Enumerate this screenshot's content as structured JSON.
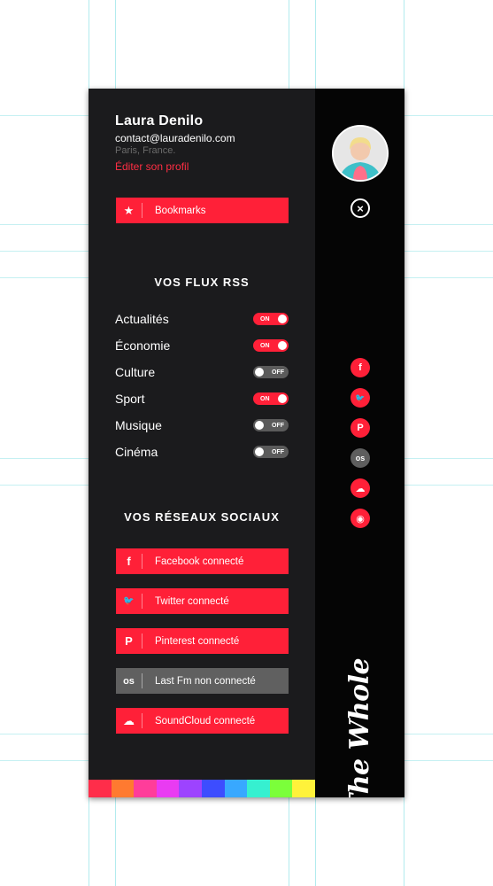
{
  "profile": {
    "name": "Laura Denilo",
    "email": "contact@lauradenilo.com",
    "location": "Paris, France.",
    "edit_label": "Éditer son profil"
  },
  "bookmarks": {
    "label": "Bookmarks",
    "icon": "star-icon"
  },
  "rss": {
    "title": "VOS FLUX RSS",
    "feeds": [
      {
        "label": "Actualités",
        "state": "ON",
        "enabled": true
      },
      {
        "label": "Économie",
        "state": "ON",
        "enabled": true
      },
      {
        "label": "Culture",
        "state": "OFF",
        "enabled": false
      },
      {
        "label": "Sport",
        "state": "ON",
        "enabled": true
      },
      {
        "label": "Musique",
        "state": "OFF",
        "enabled": false
      },
      {
        "label": "Cinéma",
        "state": "OFF",
        "enabled": false
      }
    ]
  },
  "social": {
    "title": "VOS RÉSEAUX SOCIAUX",
    "networks": [
      {
        "label": "Facebook connecté",
        "icon": "f",
        "icon_name": "facebook-icon",
        "connected": true
      },
      {
        "label": "Twitter connecté",
        "icon": "🐦",
        "icon_name": "twitter-icon",
        "connected": true
      },
      {
        "label": "Pinterest connecté",
        "icon": "P",
        "icon_name": "pinterest-icon",
        "connected": true
      },
      {
        "label": "Last Fm non connecté",
        "icon": "os",
        "icon_name": "lastfm-icon",
        "connected": false
      },
      {
        "label": "SoundCloud connecté",
        "icon": "☁",
        "icon_name": "soundcloud-icon",
        "connected": true
      }
    ]
  },
  "rail": {
    "close_icon": "×",
    "social_icons": [
      {
        "glyph": "f",
        "name": "facebook-icon",
        "active": true
      },
      {
        "glyph": "🐦",
        "name": "twitter-icon",
        "active": true
      },
      {
        "glyph": "P",
        "name": "pinterest-icon",
        "active": true
      },
      {
        "glyph": "os",
        "name": "lastfm-icon",
        "active": false
      },
      {
        "glyph": "☁",
        "name": "soundcloud-icon",
        "active": true
      },
      {
        "glyph": "◉",
        "name": "rss-icon",
        "active": true
      }
    ],
    "brand": "The Whole"
  },
  "colors": {
    "accent": "#ff2038",
    "inactive": "#5b5b5b",
    "bar": [
      "#ff2d4a",
      "#ff7a30",
      "#ff3d9a",
      "#e93bf2",
      "#9d43ff",
      "#3d4dff",
      "#38a8ff",
      "#36f0d0",
      "#7bff3a",
      "#fff23a"
    ]
  }
}
